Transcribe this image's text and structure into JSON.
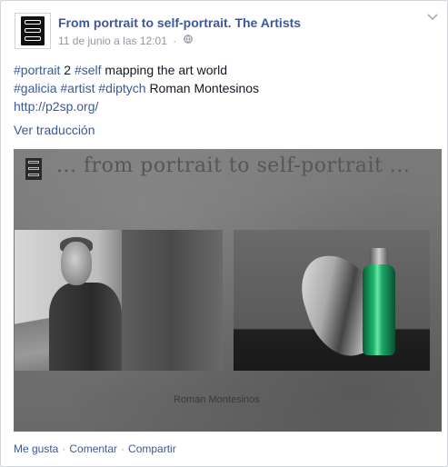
{
  "post": {
    "page_name": "From portrait to self-portrait. The Artists",
    "timestamp": "11 de junio a las 12:01",
    "privacy_icon": "globe-icon",
    "menu_icon": "chevron-down-icon",
    "text_line1": {
      "tag1": "#portrait",
      "num": "2",
      "tag2": "#self",
      "rest": "mapping the art world"
    },
    "text_line2": {
      "tag1": "#galicia",
      "tag2": "#artist",
      "tag3": "#diptych",
      "rest": "Roman Montesinos"
    },
    "link": "http://p2sp.org/",
    "translate_label": "Ver traducción"
  },
  "photo": {
    "heading": "... from portrait to self-portrait ...",
    "caption": "Roman Montesinos"
  },
  "actions": {
    "like": "Me gusta",
    "comment": "Comentar",
    "share": "Compartir",
    "separator": "·"
  },
  "colors": {
    "link": "#3b5998",
    "meta": "#9197a3",
    "background": "#ffffff"
  }
}
